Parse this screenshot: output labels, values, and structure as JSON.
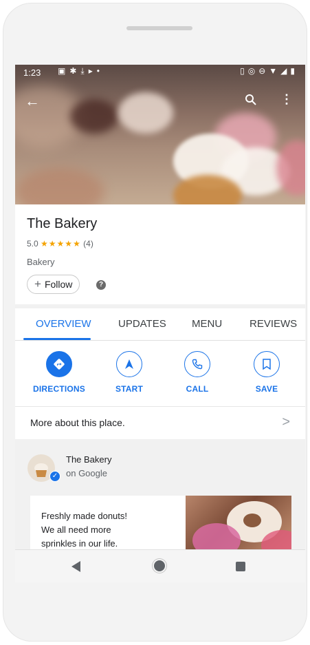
{
  "status_bar": {
    "time": "1:23"
  },
  "place": {
    "name": "The Bakery",
    "rating": "5.0",
    "stars": "★★★★★",
    "review_count": "(4)",
    "category": "Bakery",
    "follow_label": "Follow",
    "follow_prefix": "+"
  },
  "tabs": [
    {
      "label": "OVERVIEW",
      "active": true
    },
    {
      "label": "UPDATES"
    },
    {
      "label": "MENU"
    },
    {
      "label": "REVIEWS"
    }
  ],
  "actions": [
    {
      "label": "DIRECTIONS",
      "icon": "directions-icon"
    },
    {
      "label": "START",
      "icon": "navigation-arrow-icon"
    },
    {
      "label": "CALL",
      "icon": "phone-icon"
    },
    {
      "label": "SAVE",
      "icon": "bookmark-icon"
    }
  ],
  "more_about": {
    "label": "More about this place.",
    "chevron": ">"
  },
  "post": {
    "author": "The Bakery",
    "source": "on Google",
    "text_lines": [
      "Freshly made donuts!",
      "We all need more",
      "sprinkles in our life."
    ]
  },
  "colors": {
    "accent": "#1a73e8",
    "star": "#f4a300"
  }
}
